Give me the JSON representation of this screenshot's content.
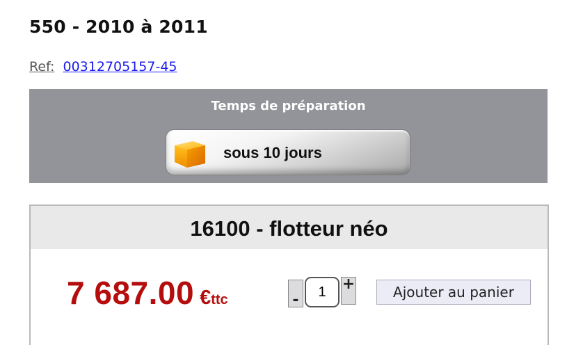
{
  "page": {
    "title": "550 - 2010 à 2011",
    "ref_label": "Ref:",
    "ref_value": "00312705157-45"
  },
  "preparation": {
    "title": "Temps de préparation",
    "badge_text": "sous 10 jours",
    "badge_icon": "box-icon"
  },
  "product": {
    "name": "16100 - flotteur néo",
    "price": "7 687.00",
    "currency": "€",
    "tax_suffix": "ttc",
    "quantity": "1",
    "minus_label": "-",
    "plus_label": "+",
    "add_to_cart_label": "Ajouter au panier"
  },
  "colors": {
    "price": "#b50d0d",
    "panel_bg": "#939499",
    "link": "#1a1aee"
  }
}
